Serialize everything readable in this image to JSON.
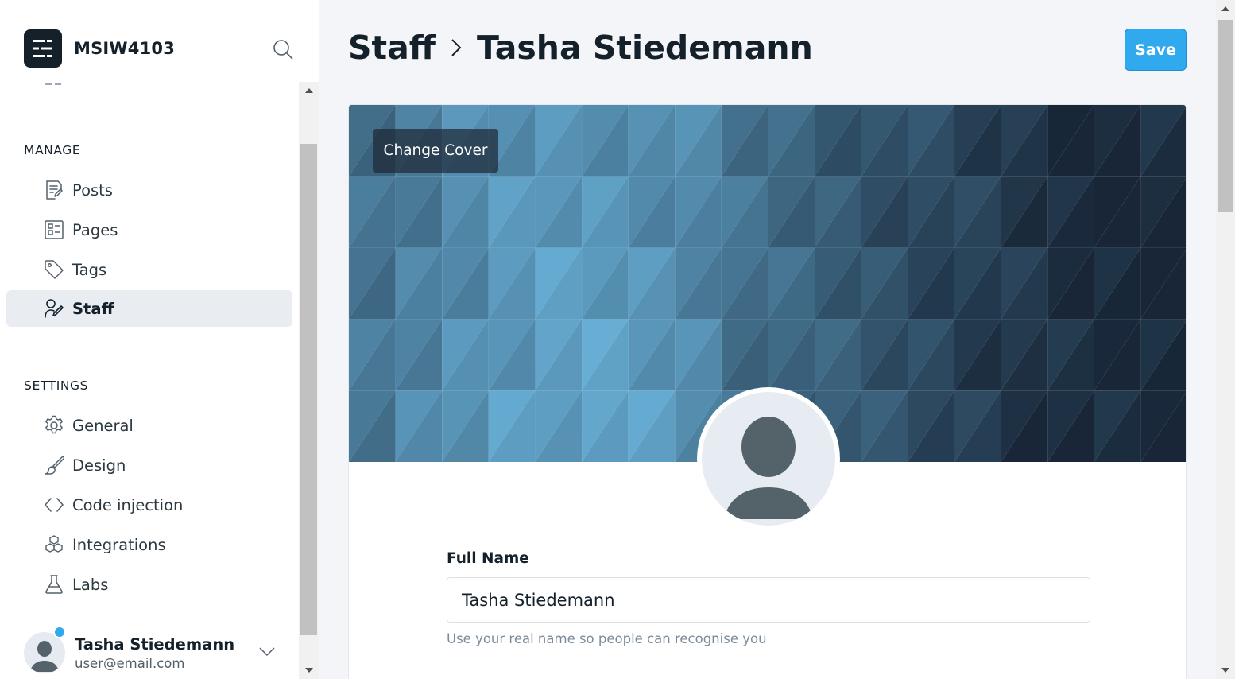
{
  "brand": {
    "name": "MSIW4103"
  },
  "sidebar": {
    "manage_label": "MANAGE",
    "manage_items": [
      {
        "label": "Posts",
        "icon": "posts-icon"
      },
      {
        "label": "Pages",
        "icon": "pages-icon"
      },
      {
        "label": "Tags",
        "icon": "tag-icon"
      },
      {
        "label": "Staff",
        "icon": "staff-icon",
        "active": true
      }
    ],
    "settings_label": "SETTINGS",
    "settings_items": [
      {
        "label": "General",
        "icon": "gear-icon"
      },
      {
        "label": "Design",
        "icon": "brush-icon"
      },
      {
        "label": "Code injection",
        "icon": "code-icon"
      },
      {
        "label": "Integrations",
        "icon": "cubes-icon"
      },
      {
        "label": "Labs",
        "icon": "flask-icon"
      }
    ],
    "user": {
      "name": "Tasha Stiedemann",
      "email": "user@email.com",
      "status_color": "#30a9ee"
    }
  },
  "header": {
    "breadcrumb_root": "Staff",
    "breadcrumb_current": "Tasha Stiedemann",
    "save_label": "Save"
  },
  "profile": {
    "change_cover_label": "Change Cover",
    "full_name_label": "Full Name",
    "full_name_value": "Tasha Stiedemann",
    "full_name_help": "Use your real name so people can recognise you"
  },
  "colors": {
    "accent": "#30a9ee",
    "text": "#15212a",
    "active_bg": "#e9ecf1"
  }
}
